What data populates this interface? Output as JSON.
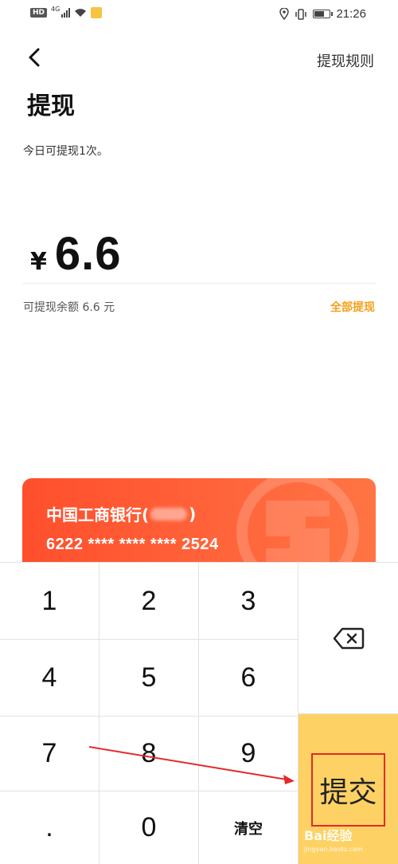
{
  "status_bar": {
    "hd": "HD",
    "network": "4G",
    "time": "21:26"
  },
  "header": {
    "rules_link": "提现规则",
    "title": "提现"
  },
  "subtitle": "今日可提现1次。",
  "amount": {
    "currency": "¥",
    "value": "6.6"
  },
  "balance_text": "可提现余额 6.6 元",
  "withdraw_all": "全部提现",
  "card": {
    "bank_name_prefix": "中国工商银行(",
    "bank_name_suffix": ")",
    "number": "6222 **** **** **** 2524"
  },
  "keypad": {
    "keys": [
      "1",
      "2",
      "3",
      "4",
      "5",
      "6",
      "7",
      "8",
      "9",
      ".",
      "0",
      "清空"
    ],
    "submit": "提交"
  },
  "colors": {
    "accent": "#f5a01a",
    "card_start": "#ff4f2c",
    "card_end": "#ff7444",
    "submit_bg": "#fdd163",
    "annotation": "#e22a2a"
  },
  "watermark": {
    "brand": "Bai经验",
    "url": "jingyan.baidu.com"
  }
}
